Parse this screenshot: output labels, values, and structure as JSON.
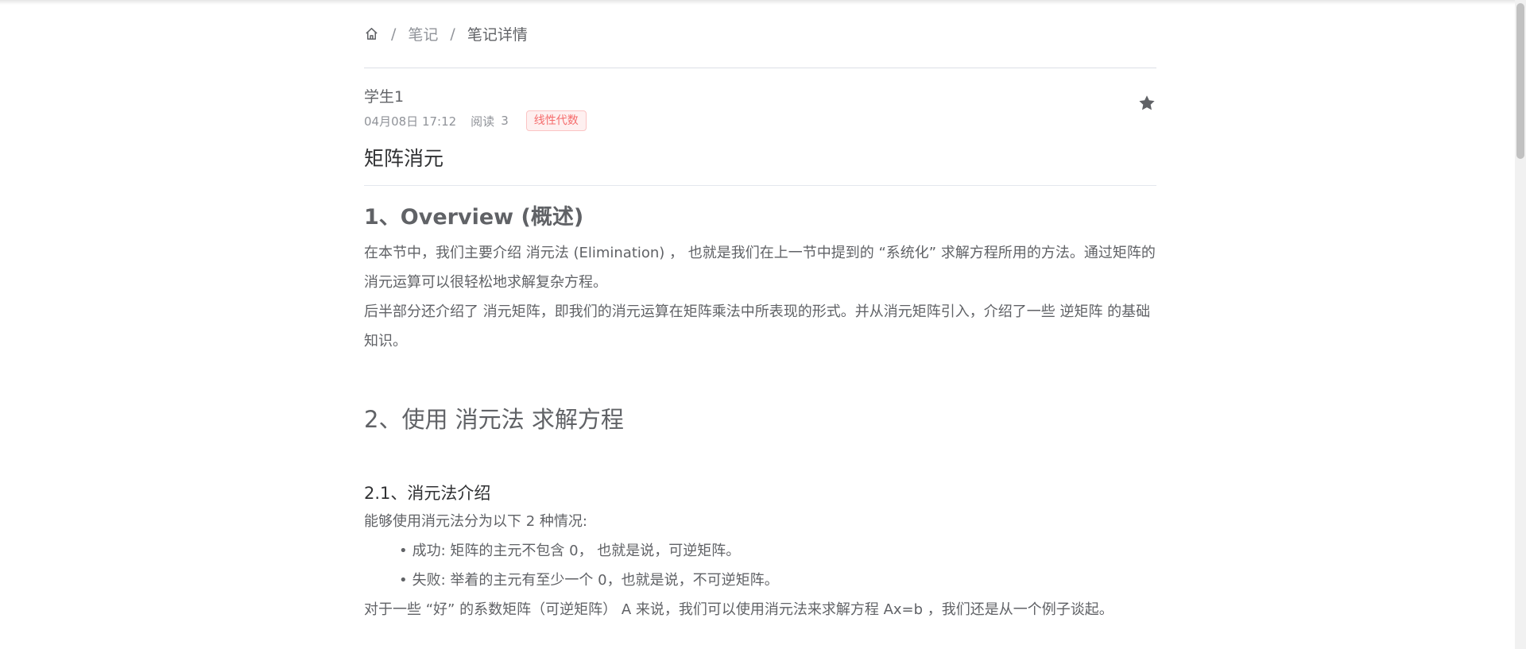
{
  "breadcrumb": {
    "home_icon": "home-icon",
    "separator": "/",
    "items": [
      {
        "label": "笔记"
      },
      {
        "label": "笔记详情"
      }
    ]
  },
  "note": {
    "author": "学生1",
    "date": "04月08日 17:12",
    "read_label": "阅读",
    "read_count": "3",
    "tag": "线性代数",
    "favorite_icon": "star-icon",
    "title": "矩阵消元"
  },
  "content": {
    "h1": "1、Overview (概述)",
    "p1": "在本节中，我们主要介绍 消元法 (Elimination) ， 也就是我们在上一节中提到的 “系统化” 求解方程所用的方法。通过矩阵的消元运算可以很轻松地求解复杂方程。",
    "p2": "后半部分还介绍了 消元矩阵，即我们的消元运算在矩阵乘法中所表现的形式。并从消元矩阵引入，介绍了一些 逆矩阵 的基础知识。",
    "h2": "2、使用 消元法 求解方程",
    "h3": "2.1、消元法介绍",
    "p3": "能够使用消元法分为以下 2 种情况:",
    "list": [
      "成功: 矩阵的主元不包含 0， 也就是说，可逆矩阵。",
      "失败: 举着的主元有至少一个 0，也就是说，不可逆矩阵。"
    ],
    "p4": "对于一些 “好” 的系数矩阵（可逆矩阵） A 来说，我们可以使用消元法来求解方程 Ax=b ，我们还是从一个例子谈起。"
  },
  "colors": {
    "tag_text": "#f56c6c",
    "tag_bg": "#fef0f0",
    "tag_border": "#fbc4c4",
    "text": "#606266",
    "muted": "#909399"
  }
}
